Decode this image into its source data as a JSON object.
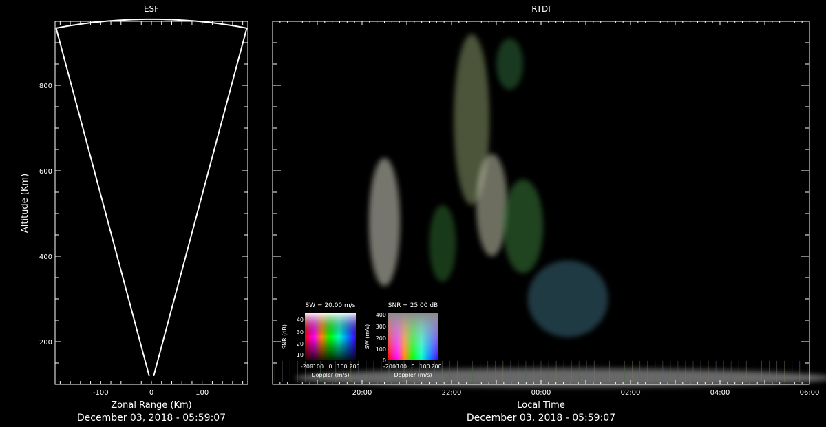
{
  "chart_data": [
    {
      "type": "sector",
      "title": "ESF",
      "xlabel": "Zonal Range (Km)",
      "ylabel": "Altitude (Km)",
      "footer": "December 03, 2018 - 05:59:07",
      "xlim": [
        -190,
        190
      ],
      "ylim": [
        100,
        950
      ],
      "xticks": [
        {
          "value": -100,
          "label": "-100"
        },
        {
          "value": 0,
          "label": "0"
        },
        {
          "value": 100,
          "label": "100"
        }
      ],
      "yticks": [
        {
          "value": 200,
          "label": "200"
        },
        {
          "value": 400,
          "label": "400"
        },
        {
          "value": 600,
          "label": "600"
        },
        {
          "value": 800,
          "label": "800"
        }
      ],
      "sector": {
        "apex_x": 0,
        "apex_y": 100,
        "half_angle_deg": 12.7,
        "outer_range_km": 855,
        "inner_range_km": 20
      },
      "line_color": "#ffffff"
    },
    {
      "type": "heatmap",
      "title": "RTDI",
      "xlabel": "Local Time",
      "footer": "December 03, 2018 - 05:59:07",
      "xlim_hours": [
        18.0,
        30.0
      ],
      "ylim": [
        100,
        950
      ],
      "xticks": [
        {
          "value": 20,
          "label": "20:00"
        },
        {
          "value": 22,
          "label": "22:00"
        },
        {
          "value": 24,
          "label": "00:00"
        },
        {
          "value": 26,
          "label": "02:00"
        },
        {
          "value": 28,
          "label": "04:00"
        },
        {
          "value": 30,
          "label": "06:00"
        }
      ],
      "echo_regions": [
        {
          "name": "plume-a",
          "t": 20.5,
          "alt": 480,
          "dt": 0.35,
          "dalt": 150,
          "color": "#d8d8c8"
        },
        {
          "name": "plume-b",
          "t": 22.45,
          "alt": 720,
          "dt": 0.4,
          "dalt": 200,
          "color": "#8a9a6a"
        },
        {
          "name": "plume-c",
          "t": 22.9,
          "alt": 520,
          "dt": 0.35,
          "dalt": 120,
          "color": "#c8c8b0"
        },
        {
          "name": "plume-d",
          "t": 23.6,
          "alt": 470,
          "dt": 0.45,
          "dalt": 110,
          "color": "#3a7a3a"
        },
        {
          "name": "plume-e",
          "t": 21.8,
          "alt": 430,
          "dt": 0.3,
          "dalt": 90,
          "color": "#2e6a2e"
        },
        {
          "name": "plume-f",
          "t": 23.3,
          "alt": 850,
          "dt": 0.3,
          "dalt": 60,
          "color": "#2f6a3a"
        },
        {
          "name": "trail",
          "t": 24.6,
          "alt": 300,
          "dt": 0.9,
          "dalt": 90,
          "color": "#3a6a7a"
        },
        {
          "name": "bottom-band",
          "t": 24.5,
          "alt": 115,
          "dt": 6.0,
          "dalt": 22,
          "color": "#bdbdbd"
        }
      ]
    }
  ],
  "legends": [
    {
      "title": "SW = 20.00 m/s",
      "xlabel": "Doppler (m/s)",
      "ylabel": "SNR (dB)",
      "xticks": [
        "-200",
        "-100",
        "0",
        "100",
        "200"
      ],
      "yticks": [
        "10",
        "20",
        "30",
        "40"
      ]
    },
    {
      "title": "SNR = 25.00 dB",
      "xlabel": "Doppler (m/s)",
      "ylabel": "SW (m/s)",
      "xticks": [
        "-200",
        "-100",
        "0",
        "100",
        "200"
      ],
      "yticks": [
        "0",
        "100",
        "200",
        "300",
        "400"
      ]
    }
  ]
}
